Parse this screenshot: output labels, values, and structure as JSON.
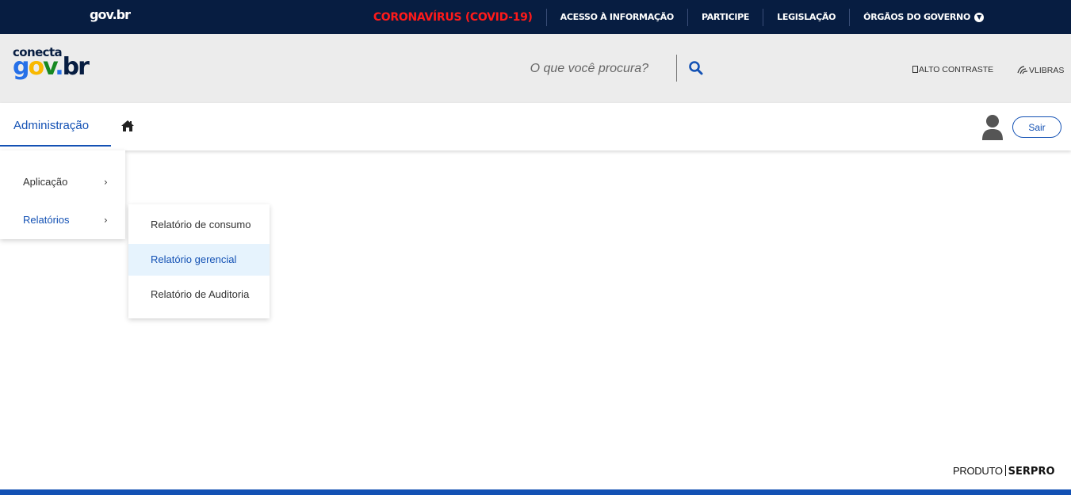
{
  "govbar": {
    "logo": "gov.br",
    "links": [
      {
        "label": "CORONAVÍRUS (COVID-19)",
        "type": "covid"
      },
      {
        "label": "ACESSO À INFORMAÇÃO"
      },
      {
        "label": "PARTICIPE"
      },
      {
        "label": "LEGISLAÇÃO"
      },
      {
        "label": "ÓRGÃOS DO GOVERNO",
        "dropdown": true
      }
    ]
  },
  "header": {
    "brand_small": "conecta",
    "brand_big": "gov.br",
    "search_placeholder": "O que você procura?",
    "accessibility": {
      "contrast": "ALTO CONTRASTE",
      "libras": "VLIBRAS"
    }
  },
  "nav": {
    "tab": "Administração",
    "logout": "Sair"
  },
  "menu": {
    "items": [
      {
        "label": "Aplicação",
        "active": false
      },
      {
        "label": "Relatórios",
        "active": true
      }
    ],
    "submenu": [
      {
        "label": "Relatório de consumo",
        "highlighted": false
      },
      {
        "label": "Relatório gerencial",
        "highlighted": true
      },
      {
        "label": "Relatório de Auditoria",
        "highlighted": false
      }
    ]
  },
  "footer": {
    "produto": "PRODUTO",
    "serpro": "SERPRO"
  },
  "colors": {
    "govbar_bg": "#071d41",
    "accent": "#1351b4",
    "covid": "#ff1a1a",
    "header_bg": "#ececec",
    "highlight_bg": "#e6f3fd"
  }
}
